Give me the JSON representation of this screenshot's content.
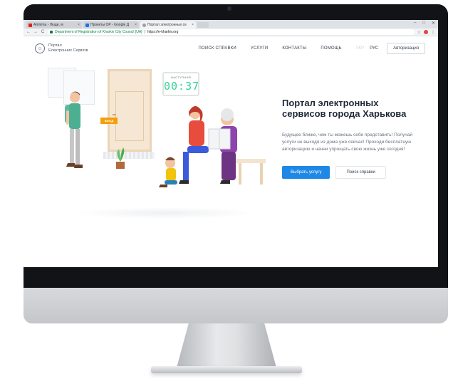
{
  "browser": {
    "tabs": [
      {
        "title": "Amnima - Люди, м",
        "favicon": "youtube-favicon",
        "active": false
      },
      {
        "title": "Проекты ОР - Google Д",
        "favicon": "sheets-favicon",
        "active": false
      },
      {
        "title": "Портал электронных се",
        "favicon": "kharkiv-favicon",
        "active": true
      }
    ],
    "tab_close": "×",
    "window_controls": {
      "minimize": "–",
      "maximize": "□",
      "close": "✕"
    },
    "address": {
      "secure_label": "Department of Registration of Kharkiv City Council [UA]",
      "separator": "|",
      "url": "https://e-kharkiv.org"
    },
    "icons": {
      "back": "←",
      "forward": "→",
      "reload": "C",
      "star": "☆",
      "menu": "⋮"
    }
  },
  "site": {
    "logo": {
      "line1": "Портал",
      "line2": "Електронних Сервісів",
      "mark": "☺"
    },
    "nav": [
      "ПОИСК СПРАВКИ",
      "УСЛУГИ",
      "КОНТАКТЫ",
      "ПОМОЩЬ"
    ],
    "languages": [
      {
        "label": "УКР",
        "active": false
      },
      {
        "label": "РУС",
        "active": true
      }
    ],
    "login_label": "Авторизация"
  },
  "illustration": {
    "timer_label": "НАСТУПНИЙ",
    "timer_value": "00:37",
    "exit_sign": "ВИХІД"
  },
  "hero": {
    "title_line1": "Портал электронных",
    "title_line2": "сервисов города Харькова",
    "description": "Будущее ближе, чем ты можешь себе представить! Получай услуги не выходя из дома уже сейчас! Проходи бесплатную авторизацию и начни упрощать свою жизнь уже сегодня!",
    "primary_button": "Выбрать услугу",
    "secondary_button": "Поиск справки"
  },
  "colors": {
    "accent": "#1e88e5",
    "timer": "#34d399",
    "bezel": "#111316"
  }
}
